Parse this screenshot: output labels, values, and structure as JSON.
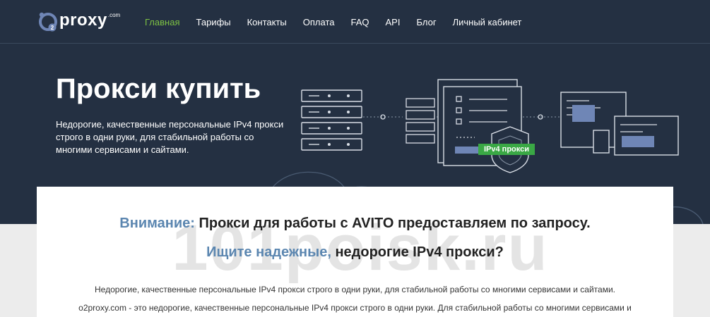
{
  "logo": {
    "text": "proxy",
    "suffix": ".com",
    "badge": "2"
  },
  "nav": [
    {
      "label": "Главная",
      "active": true
    },
    {
      "label": "Тарифы"
    },
    {
      "label": "Контакты"
    },
    {
      "label": "Оплата"
    },
    {
      "label": "FAQ"
    },
    {
      "label": "API"
    },
    {
      "label": "Блог"
    },
    {
      "label": "Личный кабинет"
    }
  ],
  "hero": {
    "title": "Прокси купить",
    "description": "Недорогие, качественные персональные IPv4 прокси строго в одни руки, для стабильной работы со многими сервисами и сайтами.",
    "badge": "IPv4 прокси"
  },
  "content": {
    "notice_highlight": "Внимание:",
    "notice_text": " Прокси для работы с AVITO предоставляем по запросу.",
    "question_highlight": "Ищите надежные,",
    "question_text": " недорогие IPv4 прокси?",
    "para1": "Недорогие, качественные персональные IPv4 прокси строго в одни руки, для стабильной работы со многими сервисами и сайтами.",
    "para2": "o2proxy.com - это недорогие, качественные персональные IPv4 прокси строго в одни руки. Для стабильной работы со многими сервисами и"
  },
  "watermark": "101poisk.ru",
  "colors": {
    "hero_bg": "#243042",
    "accent_green": "#7dc143",
    "highlight_blue": "#5b86b0",
    "badge_green": "#3aa845"
  }
}
